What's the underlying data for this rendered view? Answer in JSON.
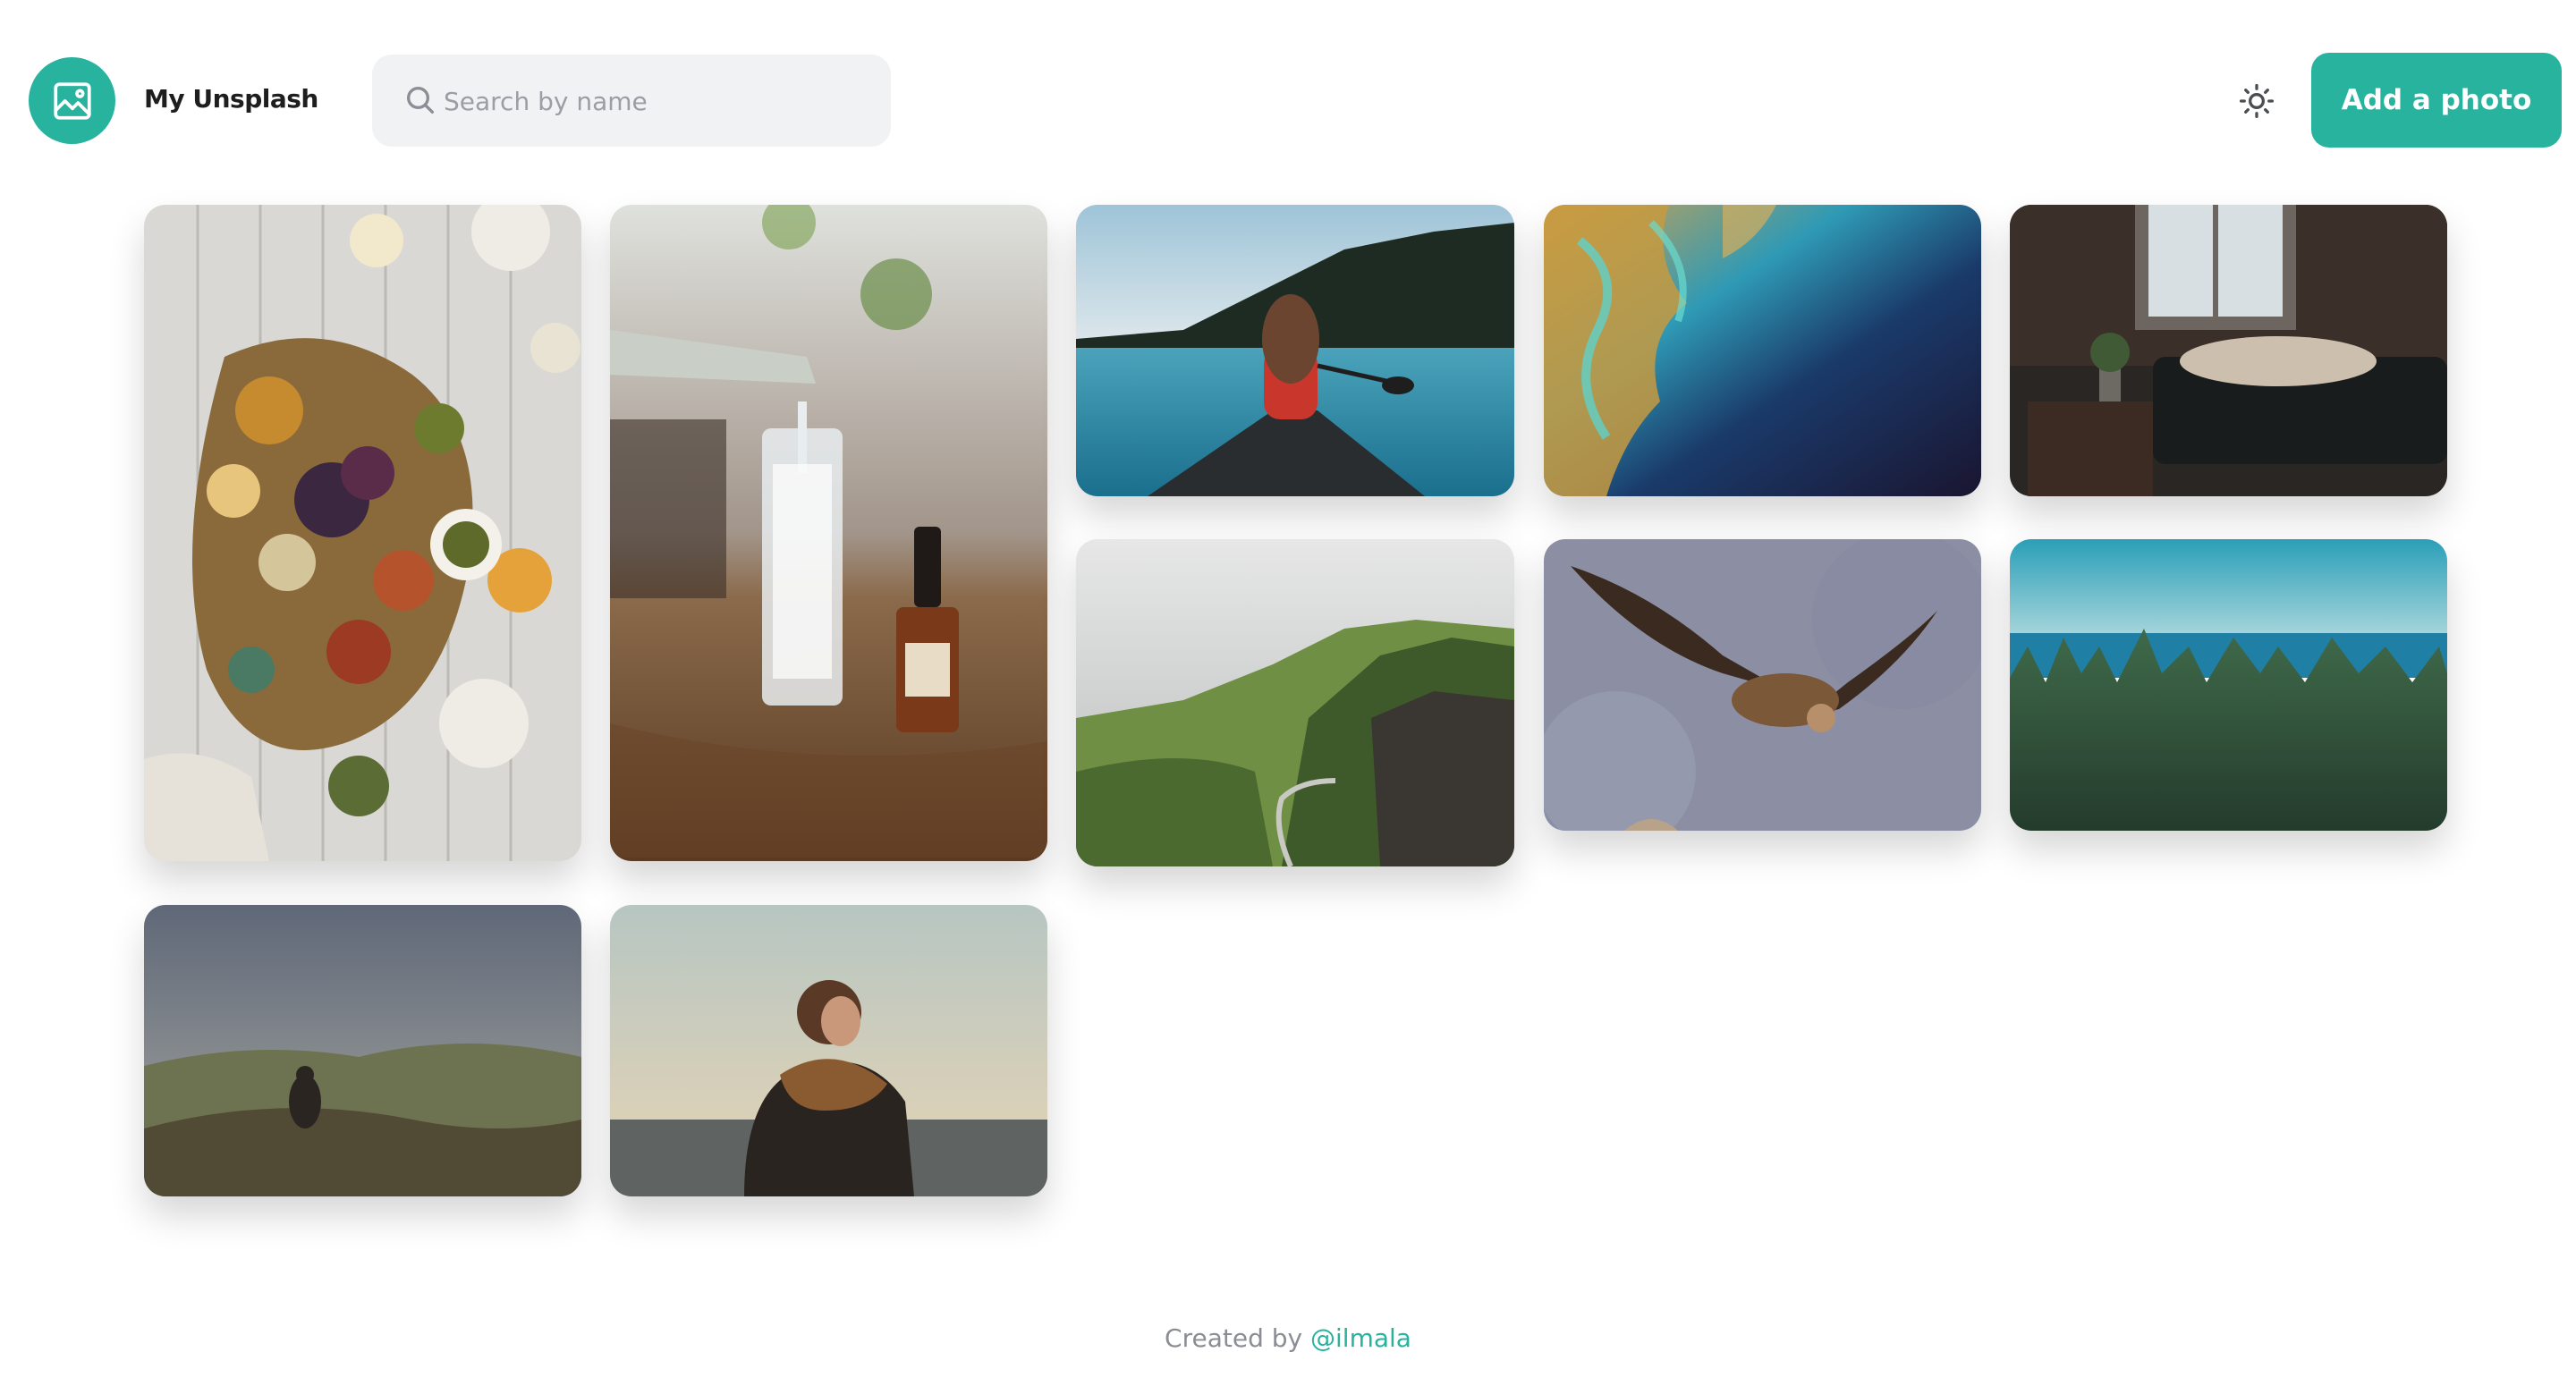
{
  "header": {
    "logo_icon": "image-icon",
    "brand": "My Unsplash",
    "search_placeholder": "Search by name",
    "search_value": "",
    "theme_icon": "sun-icon",
    "add_button": "Add a photo",
    "accent_color": "#27b39d"
  },
  "gallery": {
    "photos": [
      {
        "subject": "food platter on wooden table"
      },
      {
        "subject": "water poured into glass"
      },
      {
        "subject": "woman in canoe on lake"
      },
      {
        "subject": "aerial coastline"
      },
      {
        "subject": "person lying on sofa by window"
      },
      {
        "subject": "green cliffs with road"
      },
      {
        "subject": "vulture in flight"
      },
      {
        "subject": "forest with sea"
      },
      {
        "subject": "person sitting on rocky hill"
      },
      {
        "subject": "man with scarf at sea"
      }
    ]
  },
  "footer": {
    "prefix": "Created by",
    "author": "@ilmala"
  }
}
